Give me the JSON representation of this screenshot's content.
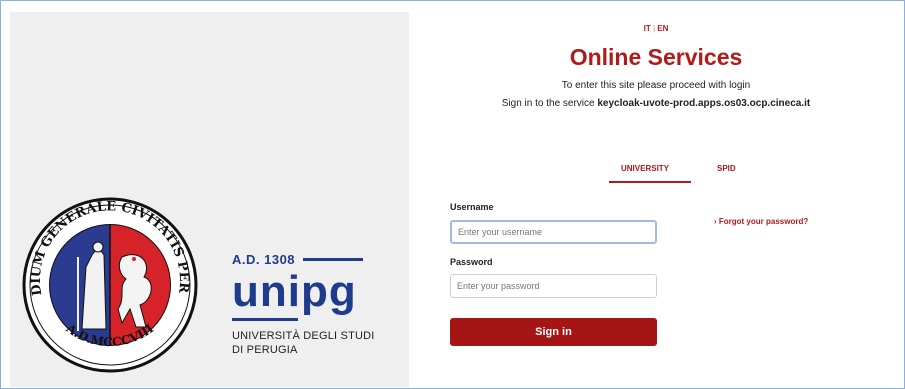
{
  "brand": {
    "ad": "A.D. 1308",
    "logo": "unipg",
    "name_line1": "UNIVERSITÀ DEGLI STUDI",
    "name_line2": "DI PERUGIA",
    "seal_text_top": "STUDIUM GENERALE CIVITATIS PERUSII",
    "seal_text_bottom": "A.D.MCCCVIII"
  },
  "lang": {
    "it": "IT",
    "en": "EN"
  },
  "header": {
    "title": "Online Services",
    "subtitle": "To enter this site please proceed with login",
    "service_prefix": "Sign in to the service",
    "service_name": "keycloak-uvote-prod.apps.os03.ocp.cineca.it"
  },
  "tabs": {
    "university": "UNIVERSITY",
    "spid": "SPID"
  },
  "form": {
    "username_label": "Username",
    "username_placeholder": "Enter your username",
    "password_label": "Password",
    "password_placeholder": "Enter your password",
    "forgot": "› Forgot your password?",
    "signin": "Sign in"
  },
  "colors": {
    "accent": "#b21a1a",
    "brand_blue": "#1f3b8c",
    "button": "#a51515"
  }
}
